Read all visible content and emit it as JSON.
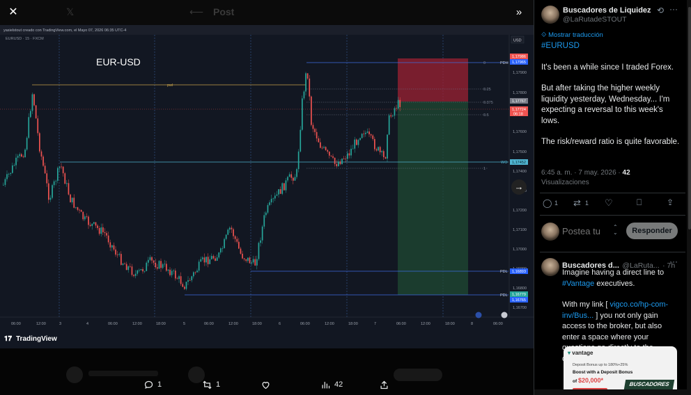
{
  "viewer": {
    "close_icon": "close-icon",
    "expand_icon": "double-chevron-right-icon",
    "ghost_title": "Post",
    "next_icon": "arrow-right-icon"
  },
  "chart": {
    "header_line": "yasielstout creado con TradingView.com, el Mayo 07, 2026 06:35 UTC-4",
    "symbol_line": "EURUSD · 15 · FXCM",
    "title_overlay": "EUR-USD",
    "currency_badge": "USD",
    "brand": "TradingView",
    "x_ticks": [
      "06:00",
      "12:00",
      "3",
      "4",
      "06:00",
      "12:00",
      "18:00",
      "5",
      "06:00",
      "12:00",
      "18:00",
      "6",
      "06:00",
      "12:00",
      "18:00",
      "7",
      "06:00",
      "12:00",
      "18:00",
      "8",
      "06:00"
    ],
    "y_ticks": [
      "1,17900",
      "1,17800",
      "1,17600",
      "1,17500",
      "1,17400",
      "1,17300",
      "1,17200",
      "1,17100",
      "1,17000",
      "1,16900",
      "1,16800",
      "1,16700"
    ],
    "labels": {
      "pdh": "PDH",
      "pwl": "pwl",
      "wo": "WO",
      "pdl1": "PDL",
      "pdl2": "PDL",
      "fib0": "0",
      "fib025": "0.25",
      "fib0375": "0.375",
      "fib05": "0.5",
      "fib1": "1"
    },
    "price_badges": {
      "red_top": "1,17986",
      "blue_top": "1,17965",
      "gray_mid": "1,17767",
      "red_mid": "1,17724",
      "red_mid_time": "06:18",
      "cyan_wo": "1,17452",
      "blue_pdl1": "1,16893",
      "green_low": "1,16779",
      "blue_pdl2": "1,16765"
    }
  },
  "actions": {
    "reply_count": "1",
    "repost_count": "1",
    "views_count": "42"
  },
  "tweet": {
    "author_name": "Buscadores de Liquidez",
    "author_handle": "@LaRutadeSTOUT",
    "translate": "Mostrar traducción",
    "hashtag": "#EURUSD",
    "p1": "It's been a while since I traded Forex.",
    "p2": "But after taking the higher weekly liquidity yesterday, Wednesday... I'm expecting a reversal to this week's lows.",
    "p3": "The risk/reward ratio is quite favorable.",
    "timestamp": "6:45 a. m. · 7 may. 2026 · ",
    "views_num": "42",
    "views_label": "Visualizaciones",
    "reply_count": "1",
    "repost_count": "1"
  },
  "compose": {
    "placeholder": "Postea tu",
    "reply_button": "Responder"
  },
  "reply": {
    "author_name": "Buscadores d...",
    "author_handle": "@LaRuta...",
    "time": "· 7h",
    "line1": "Imagine having a direct line to",
    "hashtag": "#Vantage",
    "line2": " executives.",
    "line3a": "With my link [ ",
    "link": "vigco.co/hp-com-inv/Bus...",
    "line3b": " ] you not only gain access to the broker, but also enter a space where your questions go directly to the decision-makers."
  },
  "ad": {
    "brand": "vantage",
    "line1": "Deposit Bonus up to 180%+25%",
    "line2": "Boost with a Deposit Bonus",
    "line3a": "of ",
    "amount": "$20,000*",
    "badge": "BUSCADORES"
  },
  "colors": {
    "accent": "#1d9bf0",
    "bull": "#26a69a",
    "bear": "#ef5350",
    "chart_bg": "#121722"
  }
}
